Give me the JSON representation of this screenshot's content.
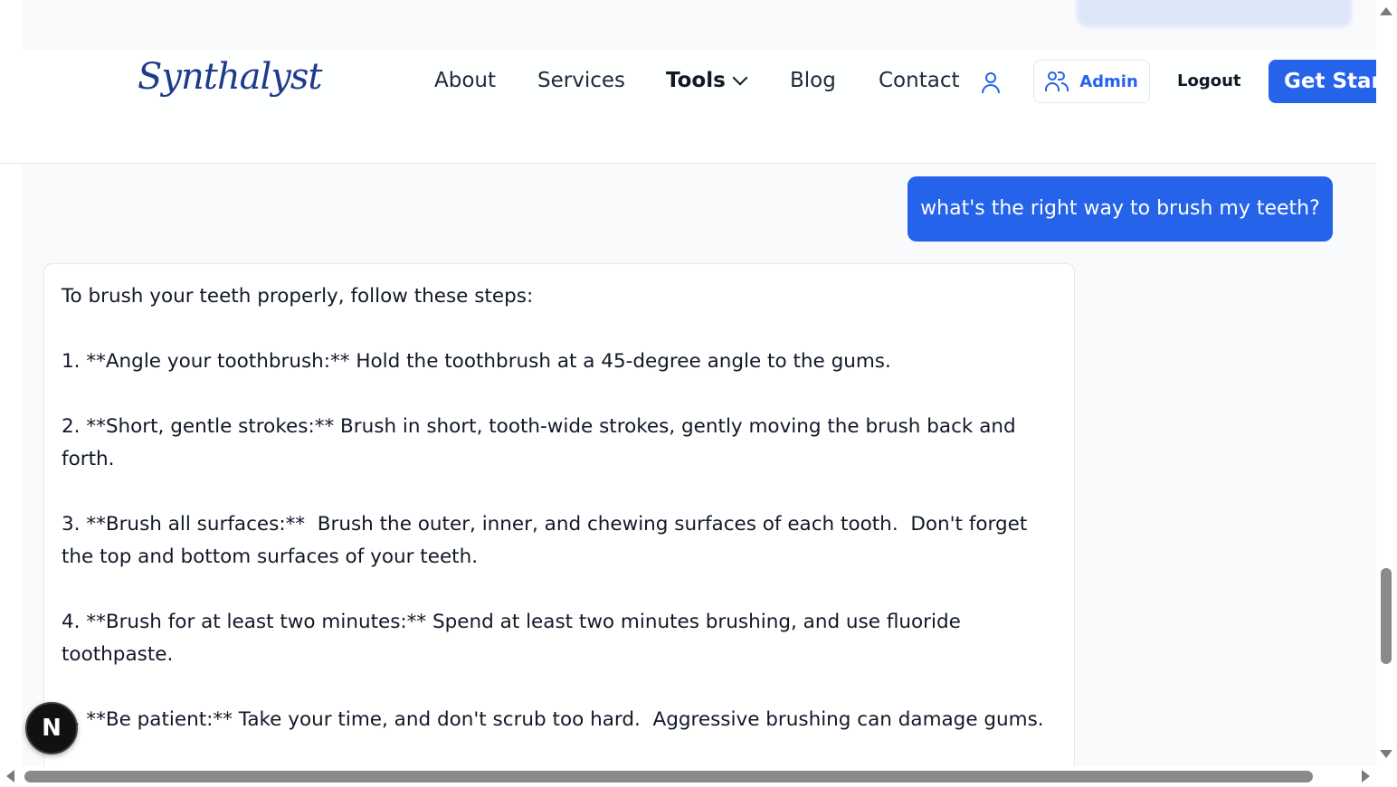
{
  "header": {
    "logo": "Synthalyst",
    "nav": {
      "about": "About",
      "services": "Services",
      "tools": "Tools",
      "blog": "Blog",
      "contact": "Contact"
    },
    "admin_label": "Admin",
    "logout_label": "Logout",
    "cta_label": "Get Start"
  },
  "chat": {
    "user_message": "what's the right way to brush my teeth?",
    "assistant_message": "To brush your teeth properly, follow these steps:\n\n1. **Angle your toothbrush:** Hold the toothbrush at a 45-degree angle to the gums.\n\n2. **Short, gentle strokes:** Brush in short, tooth-wide strokes, gently moving the brush back and\nforth.\n\n3. **Brush all surfaces:**  Brush the outer, inner, and chewing surfaces of each tooth.  Don't forget\nthe top and bottom surfaces of your teeth.\n\n4. **Brush for at least two minutes:** Spend at least two minutes brushing, and use fluoride\ntoothpaste.\n\n5. **Be patient:** Take your time, and don't scrub too hard.  Aggressive brushing can damage gums."
  },
  "badge": {
    "letter": "N"
  },
  "colors": {
    "accent": "#2563eb",
    "text": "#111827",
    "chat_bg": "#f8fafc"
  },
  "icons": {
    "user": "user-icon",
    "users": "users-icon",
    "chevron": "chevron-down-icon"
  }
}
